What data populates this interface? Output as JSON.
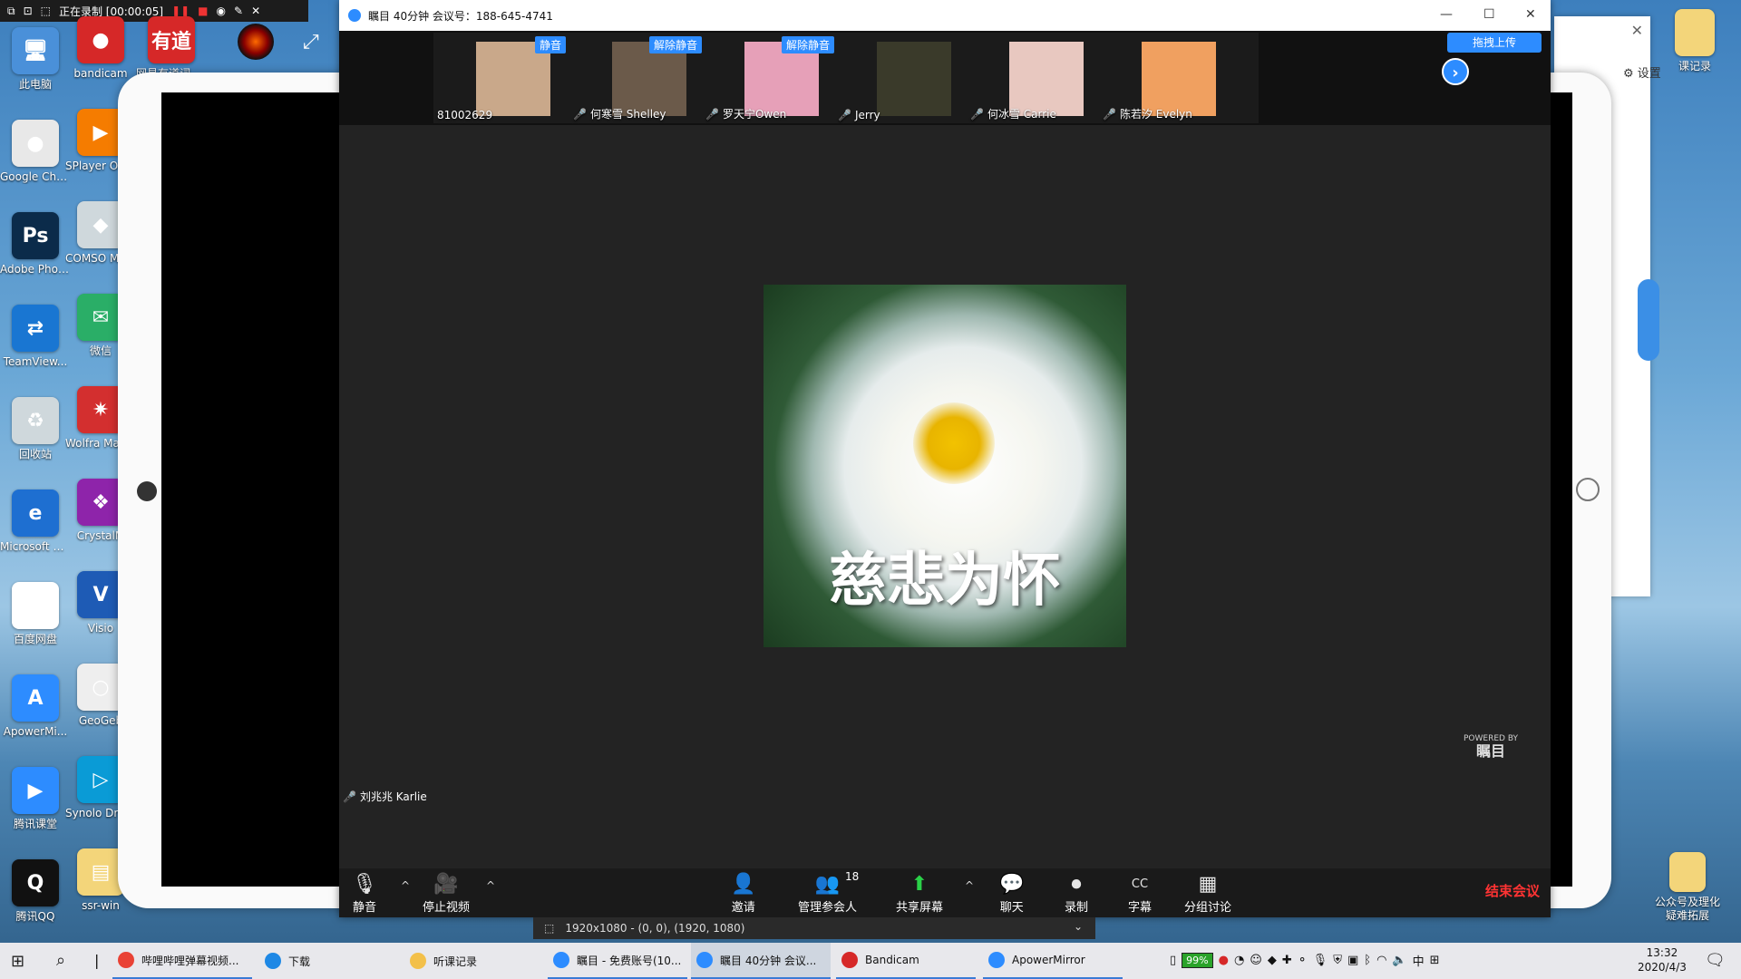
{
  "recorder": {
    "status": "正在录制 [00:00:05]"
  },
  "desktop": {
    "left_icons": [
      {
        "label": "此电脑",
        "color": "#4a90d9",
        "glyph": "🖥"
      },
      {
        "label": "Google Chrome",
        "color": "#e8e8e8",
        "glyph": "●"
      },
      {
        "label": "Adobe Photosh...",
        "color": "#0b2b4a",
        "glyph": "Ps"
      },
      {
        "label": "TeamView...",
        "color": "#1976d2",
        "glyph": "⇄"
      },
      {
        "label": "回收站",
        "color": "#cfd8dc",
        "glyph": "♻"
      },
      {
        "label": "Microsoft Edge",
        "color": "#1e6fd1",
        "glyph": "e"
      },
      {
        "label": "百度网盘",
        "color": "#ffffff",
        "glyph": "☁"
      },
      {
        "label": "ApowerMi...",
        "color": "#2d8cff",
        "glyph": "A"
      },
      {
        "label": "腾讯课堂",
        "color": "#2d8cff",
        "glyph": "▶"
      },
      {
        "label": "腾讯QQ",
        "color": "#111111",
        "glyph": "Q"
      }
    ],
    "second_icons": [
      {
        "label": "bandicam",
        "color": "#d62828",
        "glyph": "●"
      },
      {
        "label": "SPlayer One Bro",
        "color": "#f57c00",
        "glyph": "▶"
      },
      {
        "label": "COMSO Multiphy",
        "color": "#cfd8dc",
        "glyph": "◆"
      },
      {
        "label": "微信",
        "color": "#2aae67",
        "glyph": "✉"
      },
      {
        "label": "Wolfra Mathem",
        "color": "#d32f2f",
        "glyph": "✷"
      },
      {
        "label": "CrystalM",
        "color": "#8e24aa",
        "glyph": "❖"
      },
      {
        "label": "Visio",
        "color": "#1e5bb5",
        "glyph": "V"
      },
      {
        "label": "GeoGeb",
        "color": "#eeeeee",
        "glyph": "○"
      },
      {
        "label": "Synolo Drive cli",
        "color": "#0a9bd6",
        "glyph": "▷"
      },
      {
        "label": "ssr-win",
        "color": "#f3d57a",
        "glyph": "▤"
      }
    ],
    "top_extra": [
      "网易有道词典 全...",
      "有道"
    ],
    "right_icons": [
      {
        "label": "课记录",
        "color": "#f3d57a"
      },
      {
        "label": "公众号及理化 疑难拓展",
        "color": "#f3d57a"
      }
    ]
  },
  "right_window": {
    "settings_label": "⚙ 设置"
  },
  "zoom": {
    "title": "瞩目 40分钟 会议号：188-645-4741",
    "upload_label": "拖拽上传",
    "participants": [
      {
        "name": "81002629",
        "muted": false,
        "badge": "静音",
        "color": "#c9a88a"
      },
      {
        "name": "何寒雪 Shelley",
        "muted": true,
        "badge": "解除静音",
        "color": "#6b5a4a"
      },
      {
        "name": "罗天宁Owen",
        "muted": true,
        "badge": "解除静音",
        "color": "#e6a0b8"
      },
      {
        "name": "Jerry",
        "muted": true,
        "badge": "",
        "color": "#3a3a2a"
      },
      {
        "name": "何冰雪 Carrie",
        "muted": true,
        "badge": "",
        "color": "#e8c8c0"
      },
      {
        "name": "陈若汐 Evelyn",
        "muted": true,
        "badge": "",
        "color": "#f0a060"
      }
    ],
    "shared_text": "慈悲为怀",
    "powered_by": "POWERED BY",
    "brand": "瞩目",
    "speaker": "刘兆兆 Karlie",
    "toolbar": {
      "mute": "静音",
      "stop_video": "停止视频",
      "invite": "邀请",
      "manage": "管理参会人",
      "participant_count": "18",
      "share": "共享屏幕",
      "chat": "聊天",
      "record": "录制",
      "captions": "字幕",
      "breakout": "分组讨论",
      "end": "结束会议"
    }
  },
  "resolution_bar": {
    "text": "1920x1080 - (0, 0), (1920, 1080)"
  },
  "taskbar": {
    "tasks": [
      {
        "label": "哔哩哔哩弹幕视频...",
        "color": "#e94235",
        "state": "open"
      },
      {
        "label": "下载",
        "color": "#1e88e5",
        "state": ""
      },
      {
        "label": "听课记录",
        "color": "#f3c04a",
        "state": ""
      },
      {
        "label": "瞩目 - 免费账号(10...",
        "color": "#2d8cff",
        "state": "open"
      },
      {
        "label": "瞩目 40分钟 会议...",
        "color": "#2d8cff",
        "state": "active"
      },
      {
        "label": "Bandicam",
        "color": "#d62828",
        "state": "open"
      },
      {
        "label": "ApowerMirror",
        "color": "#2d8cff",
        "state": "open"
      }
    ],
    "battery": "99%",
    "ime": "中",
    "time": "13:32",
    "date": "2020/4/3"
  }
}
